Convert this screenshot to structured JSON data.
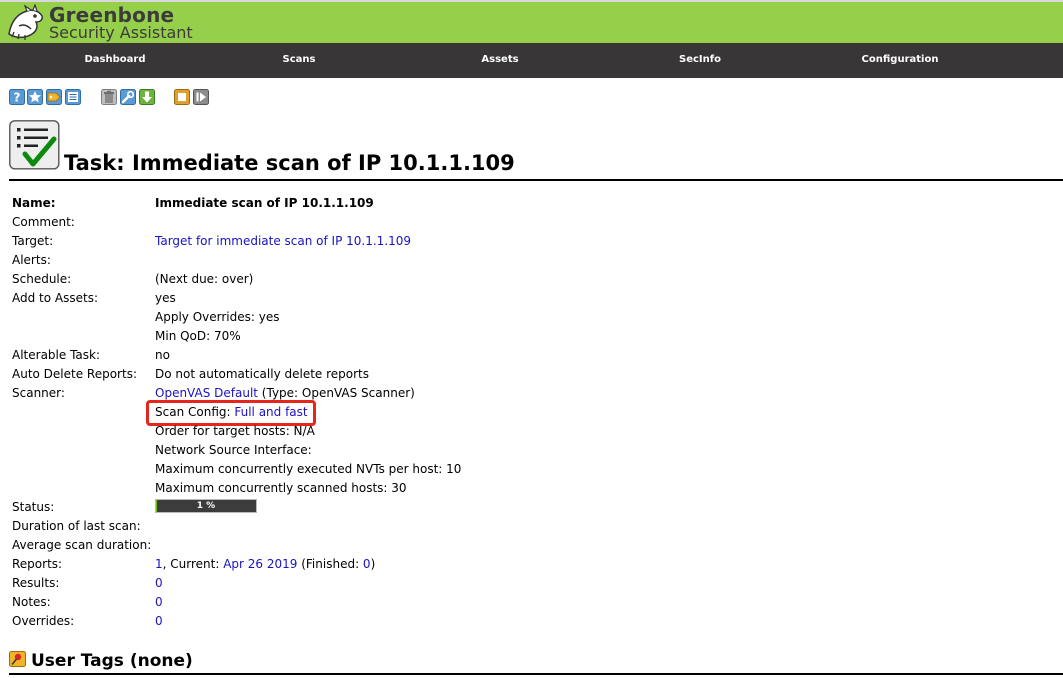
{
  "app": {
    "logo_title": "Greenbone",
    "logo_subtitle": "Security Assistant",
    "header_color": "#96d04a",
    "nav_color": "#393637",
    "link_color": "#1a13c0",
    "highlight_color": "#e4261c"
  },
  "nav": {
    "items": [
      "Dashboard",
      "Scans",
      "Assets",
      "SecInfo",
      "Configuration"
    ]
  },
  "toolbar": {
    "icons": [
      "help-icon",
      "new-task-icon",
      "edit-tag-icon",
      "list-icon",
      "trash-icon",
      "edit-wrench-icon",
      "export-icon",
      "stop-icon",
      "resume-icon"
    ]
  },
  "task": {
    "title": "Task: Immediate scan of IP 10.1.1.109",
    "labels": {
      "name": "Name:",
      "comment": "Comment:",
      "target": "Target:",
      "alerts": "Alerts:",
      "schedule": "Schedule:",
      "add_to_assets": "Add to Assets:",
      "alterable": "Alterable Task:",
      "auto_delete": "Auto Delete Reports:",
      "scanner": "Scanner:",
      "status": "Status:",
      "duration_last": "Duration of last scan:",
      "avg_duration": "Average scan duration:",
      "reports": "Reports:",
      "results": "Results:",
      "notes": "Notes:",
      "overrides": "Overrides:"
    },
    "name": "Immediate scan of IP 10.1.1.109",
    "comment": "",
    "target_link": "Target for immediate scan of IP 10.1.1.109",
    "alerts": "",
    "schedule": "(Next due: over)",
    "add_to_assets": "yes",
    "apply_overrides": "Apply Overrides: yes",
    "min_qod": "Min QoD: 70%",
    "alterable": "no",
    "auto_delete": "Do not automatically delete reports",
    "scanner_link": "OpenVAS Default",
    "scanner_type": " (Type: OpenVAS Scanner)",
    "scan_config_label": "Scan Config: ",
    "scan_config_link": "Full and fast",
    "order_hosts": "Order for target hosts: N/A",
    "network_source": "Network Source Interface:",
    "max_nvts": "Maximum concurrently executed NVTs per host: 10",
    "max_hosts": "Maximum concurrently scanned hosts: 30",
    "status_progress": 1,
    "status_text": "1 %",
    "reports_count": "1",
    "reports_current_label": ", Current: ",
    "reports_current_link": "Apr 26 2019",
    "reports_finished_label": " (Finished: ",
    "reports_finished_link": "0",
    "reports_close": ")",
    "results": "0",
    "notes": "0",
    "overrides": "0"
  },
  "user_tags": {
    "title": "User Tags (none)"
  }
}
